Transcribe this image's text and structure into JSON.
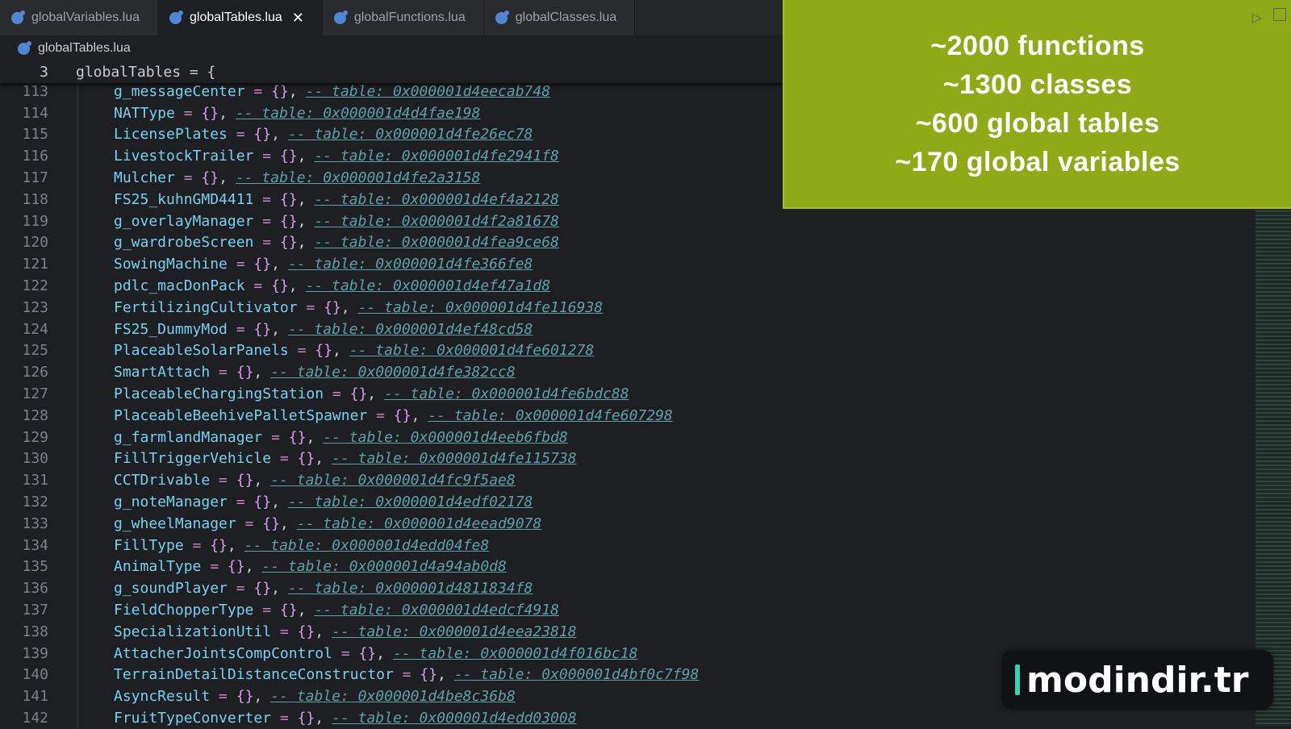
{
  "tabs": [
    {
      "label": "globalVariables.lua",
      "active": false
    },
    {
      "label": "globalTables.lua",
      "active": true
    },
    {
      "label": "globalFunctions.lua",
      "active": false
    },
    {
      "label": "globalClasses.lua",
      "active": false
    }
  ],
  "close_glyph": "✕",
  "breadcrumb": "globalTables.lua",
  "sticky": {
    "line": "3",
    "code": "globalTables = {"
  },
  "lines": [
    {
      "n": "113",
      "name": "g_messageCenter",
      "addr": "-- table: 0x000001d4eecab748"
    },
    {
      "n": "114",
      "name": "NATType",
      "addr": "-- table: 0x000001d4d4fae198"
    },
    {
      "n": "115",
      "name": "LicensePlates",
      "addr": "-- table: 0x000001d4fe26ec78"
    },
    {
      "n": "116",
      "name": "LivestockTrailer",
      "addr": "-- table: 0x000001d4fe2941f8"
    },
    {
      "n": "117",
      "name": "Mulcher",
      "addr": "-- table: 0x000001d4fe2a3158"
    },
    {
      "n": "118",
      "name": "FS25_kuhnGMD4411",
      "addr": "-- table: 0x000001d4ef4a2128"
    },
    {
      "n": "119",
      "name": "g_overlayManager",
      "addr": "-- table: 0x000001d4f2a81678"
    },
    {
      "n": "120",
      "name": "g_wardrobeScreen",
      "addr": "-- table: 0x000001d4fea9ce68"
    },
    {
      "n": "121",
      "name": "SowingMachine",
      "addr": "-- table: 0x000001d4fe366fe8"
    },
    {
      "n": "122",
      "name": "pdlc_macDonPack",
      "addr": "-- table: 0x000001d4ef47a1d8"
    },
    {
      "n": "123",
      "name": "FertilizingCultivator",
      "addr": "-- table: 0x000001d4fe116938"
    },
    {
      "n": "124",
      "name": "FS25_DummyMod",
      "addr": "-- table: 0x000001d4ef48cd58"
    },
    {
      "n": "125",
      "name": "PlaceableSolarPanels",
      "addr": "-- table: 0x000001d4fe601278"
    },
    {
      "n": "126",
      "name": "SmartAttach",
      "addr": "-- table: 0x000001d4fe382cc8"
    },
    {
      "n": "127",
      "name": "PlaceableChargingStation",
      "addr": "-- table: 0x000001d4fe6bdc88"
    },
    {
      "n": "128",
      "name": "PlaceableBeehivePalletSpawner",
      "addr": "-- table: 0x000001d4fe607298"
    },
    {
      "n": "129",
      "name": "g_farmlandManager",
      "addr": "-- table: 0x000001d4eeb6fbd8"
    },
    {
      "n": "130",
      "name": "FillTriggerVehicle",
      "addr": "-- table: 0x000001d4fe115738"
    },
    {
      "n": "131",
      "name": "CCTDrivable",
      "addr": "-- table: 0x000001d4fc9f5ae8"
    },
    {
      "n": "132",
      "name": "g_noteManager",
      "addr": "-- table: 0x000001d4edf02178"
    },
    {
      "n": "133",
      "name": "g_wheelManager",
      "addr": "-- table: 0x000001d4eead9078"
    },
    {
      "n": "134",
      "name": "FillType",
      "addr": "-- table: 0x000001d4edd04fe8"
    },
    {
      "n": "135",
      "name": "AnimalType",
      "addr": "-- table: 0x000001d4a94ab0d8"
    },
    {
      "n": "136",
      "name": "g_soundPlayer",
      "addr": "-- table: 0x000001d4811834f8"
    },
    {
      "n": "137",
      "name": "FieldChopperType",
      "addr": "-- table: 0x000001d4edcf4918"
    },
    {
      "n": "138",
      "name": "SpecializationUtil",
      "addr": "-- table: 0x000001d4eea23818"
    },
    {
      "n": "139",
      "name": "AttacherJointsCompControl",
      "addr": "-- table: 0x000001d4f016bc18"
    },
    {
      "n": "140",
      "name": "TerrainDetailDistanceConstructor",
      "addr": "-- table: 0x000001d4bf0c7f98"
    },
    {
      "n": "141",
      "name": "AsyncResult",
      "addr": "-- table: 0x000001d4be8c36b8"
    },
    {
      "n": "142",
      "name": "FruitTypeConverter",
      "addr": "-- table: 0x000001d4edd03008"
    }
  ],
  "banner": {
    "line1": "~2000 functions",
    "line2": "~1300 classes",
    "line3": "~600 global tables",
    "line4": "~170 global variables"
  },
  "watermark": "modindir.tr",
  "colors": {
    "banner": "#8faa17",
    "accent": "#39d0b0"
  }
}
